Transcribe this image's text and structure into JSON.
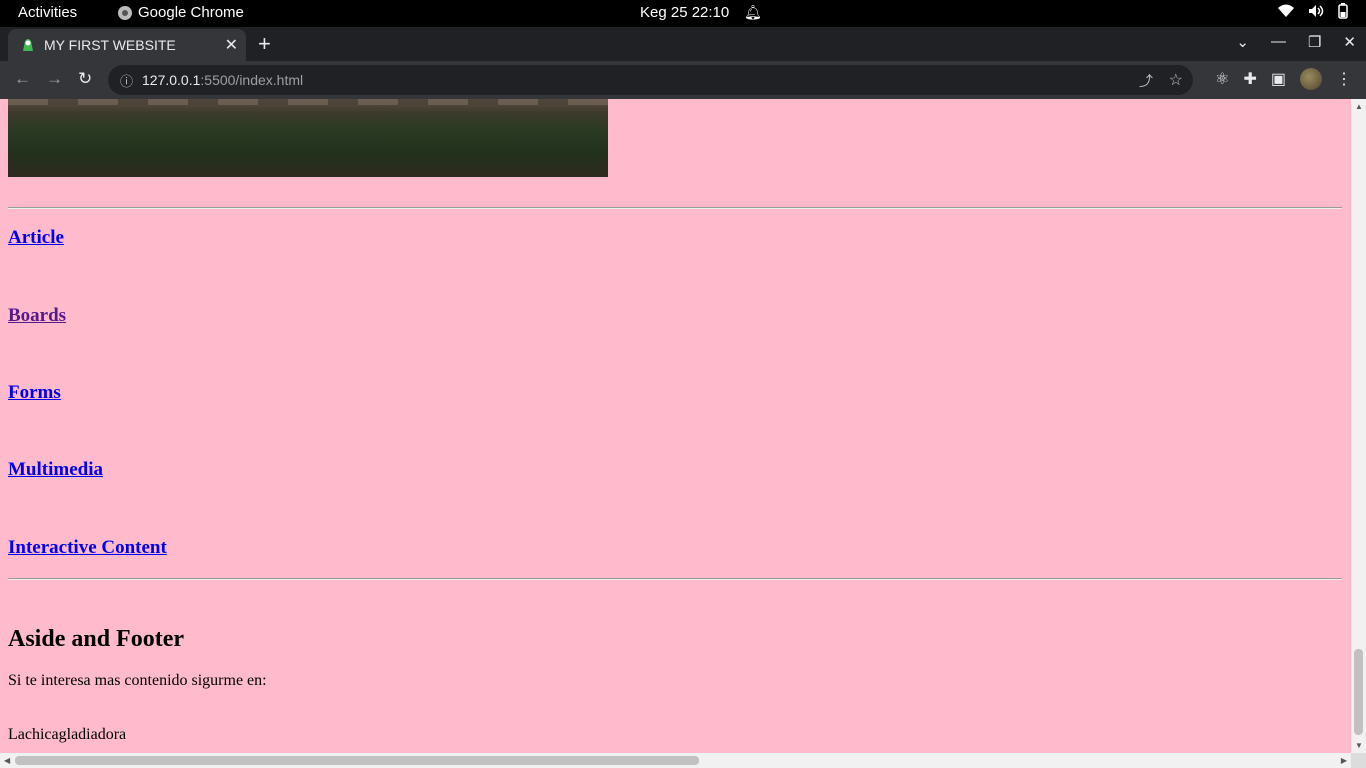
{
  "system_bar": {
    "activities": "Activities",
    "app_name": "Google Chrome",
    "clock": "Keg 25  22:10"
  },
  "browser": {
    "tab_title": "MY FIRST WEBSITE",
    "url_host": "127.0.0.1",
    "url_rest": ":5500/index.html"
  },
  "page": {
    "links": [
      {
        "label": "Article",
        "visited": false
      },
      {
        "label": "Boards",
        "visited": true
      },
      {
        "label": "Forms",
        "visited": false
      },
      {
        "label": "Multimedia",
        "visited": false
      },
      {
        "label": "Interactive Content",
        "visited": false
      }
    ],
    "aside_heading": "Aside and Footer",
    "aside_text": "Si te interesa mas contenido sigurme en:",
    "footer_name": "Lachicagladiadora"
  },
  "colors": {
    "page_background": "#ffbbcb",
    "link": "#0000ee",
    "visited_link": "#551a8b"
  }
}
